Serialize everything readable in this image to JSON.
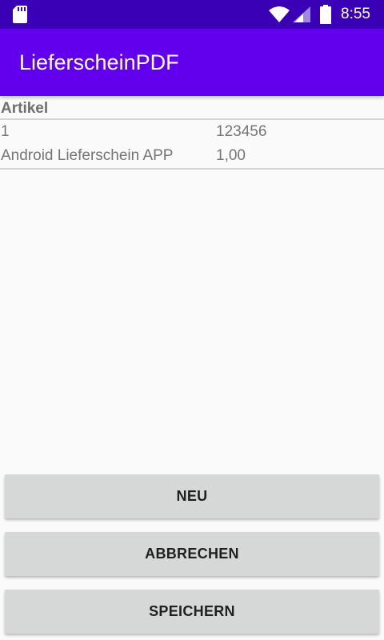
{
  "status_bar": {
    "time": "8:55",
    "icons": [
      "sd-card-icon",
      "wifi-icon",
      "signal-icon",
      "battery-icon"
    ]
  },
  "app_bar": {
    "title": "LieferscheinPDF",
    "color": "#6200ee",
    "status_color": "#3a00b5"
  },
  "table": {
    "header": "Artikel",
    "rows": [
      {
        "col1": "1",
        "col2": "123456"
      },
      {
        "col1": "Android Lieferschein APP",
        "col2": "1,00"
      }
    ]
  },
  "buttons": {
    "neu": "NEU",
    "abbrechen": "ABBRECHEN",
    "speichern": "SPEICHERN"
  }
}
